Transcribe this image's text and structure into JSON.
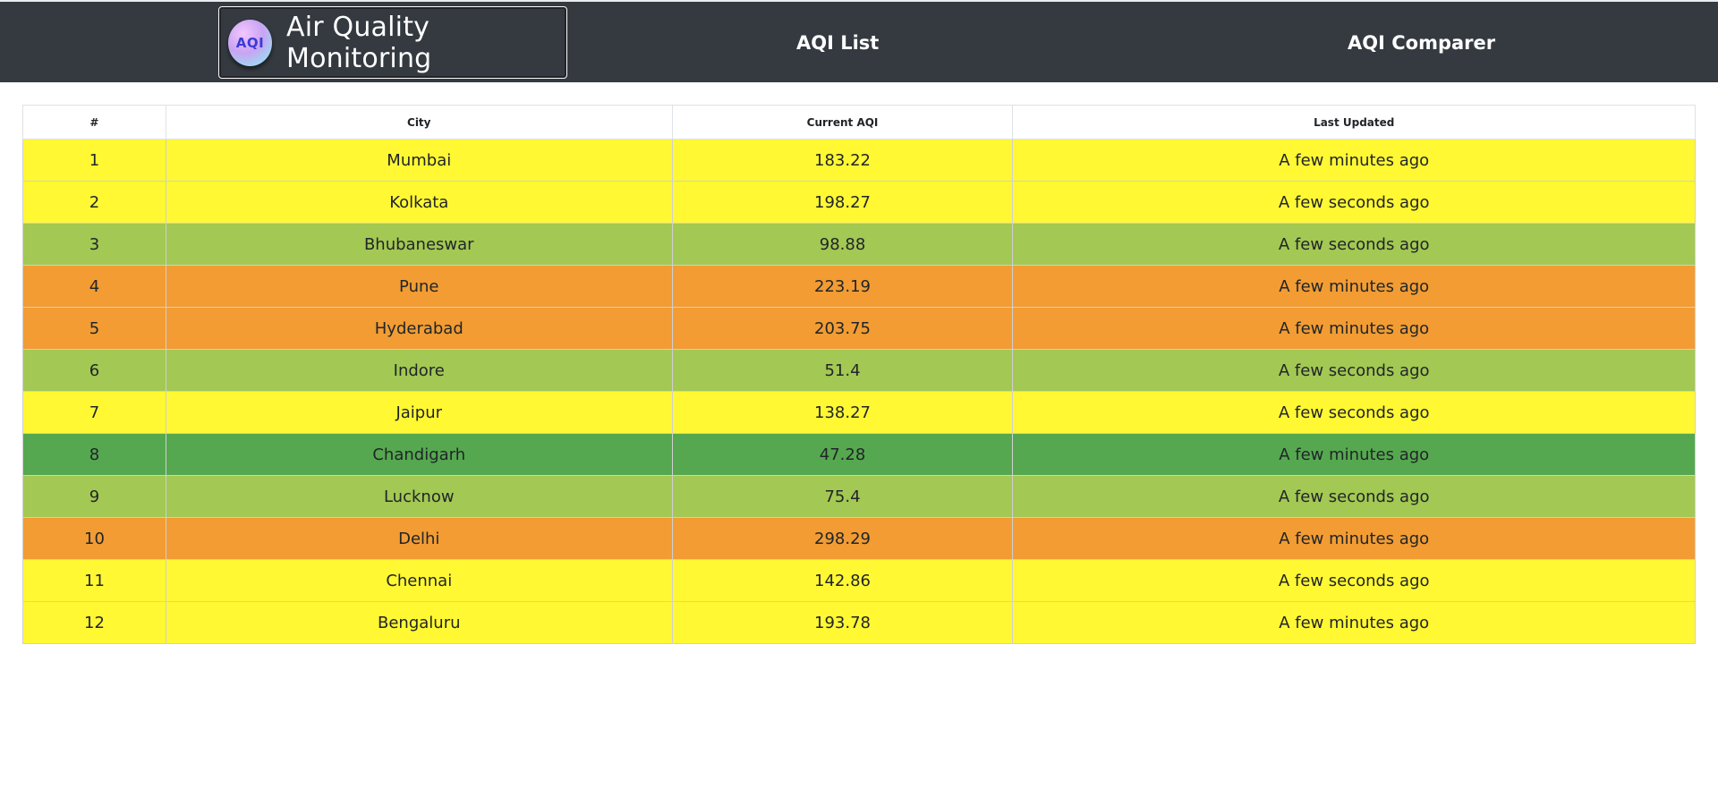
{
  "header": {
    "logo_text": "AQI",
    "title": "Air Quality Monitoring",
    "nav": [
      "AQI List",
      "AQI Comparer"
    ]
  },
  "table": {
    "columns": [
      "#",
      "City",
      "Current AQI",
      "Last Updated"
    ],
    "colors": {
      "good": "#55a84f",
      "satisfactory": "#a3c853",
      "moderate": "#fff833",
      "poor": "#f29c33"
    },
    "rows": [
      {
        "index": "1",
        "city": "Mumbai",
        "aqi": "183.22",
        "updated": "A few minutes ago",
        "level": "moderate"
      },
      {
        "index": "2",
        "city": "Kolkata",
        "aqi": "198.27",
        "updated": "A few seconds ago",
        "level": "moderate"
      },
      {
        "index": "3",
        "city": "Bhubaneswar",
        "aqi": "98.88",
        "updated": "A few seconds ago",
        "level": "satisfactory"
      },
      {
        "index": "4",
        "city": "Pune",
        "aqi": "223.19",
        "updated": "A few minutes ago",
        "level": "poor"
      },
      {
        "index": "5",
        "city": "Hyderabad",
        "aqi": "203.75",
        "updated": "A few minutes ago",
        "level": "poor"
      },
      {
        "index": "6",
        "city": "Indore",
        "aqi": "51.4",
        "updated": "A few seconds ago",
        "level": "satisfactory"
      },
      {
        "index": "7",
        "city": "Jaipur",
        "aqi": "138.27",
        "updated": "A few seconds ago",
        "level": "moderate"
      },
      {
        "index": "8",
        "city": "Chandigarh",
        "aqi": "47.28",
        "updated": "A few minutes ago",
        "level": "good"
      },
      {
        "index": "9",
        "city": "Lucknow",
        "aqi": "75.4",
        "updated": "A few seconds ago",
        "level": "satisfactory"
      },
      {
        "index": "10",
        "city": "Delhi",
        "aqi": "298.29",
        "updated": "A few minutes ago",
        "level": "poor"
      },
      {
        "index": "11",
        "city": "Chennai",
        "aqi": "142.86",
        "updated": "A few seconds ago",
        "level": "moderate"
      },
      {
        "index": "12",
        "city": "Bengaluru",
        "aqi": "193.78",
        "updated": "A few minutes ago",
        "level": "moderate"
      }
    ]
  }
}
